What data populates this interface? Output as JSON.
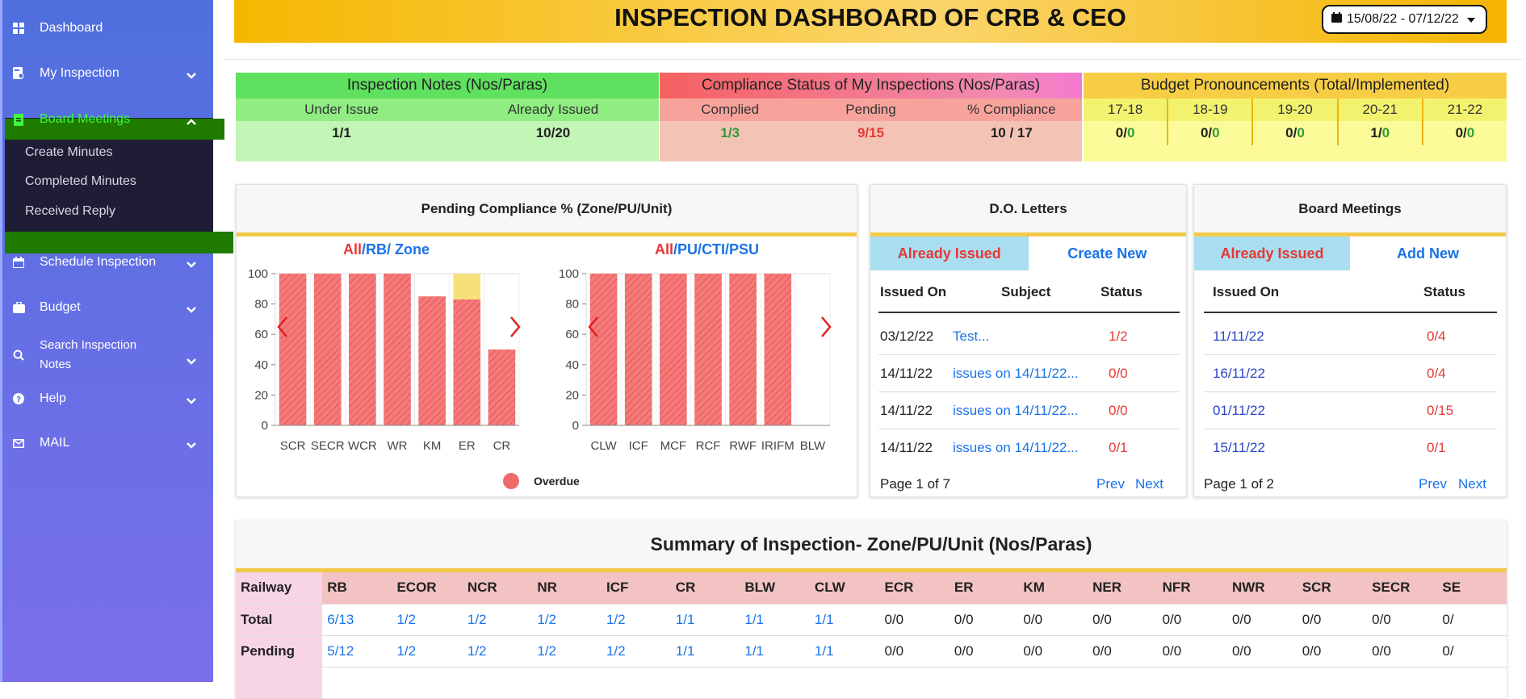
{
  "sidebar": {
    "items": [
      {
        "label": "Dashboard",
        "icon": "dashboard-icon"
      },
      {
        "label": "My Inspection",
        "icon": "inspection-icon"
      },
      {
        "label": "Board Meetings",
        "icon": "document-icon"
      },
      {
        "label": "Schedule Inspection",
        "icon": "calendar-icon"
      },
      {
        "label": "Budget",
        "icon": "briefcase-icon"
      },
      {
        "label": "Search Inspection",
        "label2": "Notes",
        "icon": "search-icon"
      },
      {
        "label": "Help",
        "icon": "help-icon"
      },
      {
        "label": "MAIL",
        "icon": "mail-icon"
      }
    ],
    "submenu": [
      "Create Minutes",
      "Completed Minutes",
      "Received Reply"
    ]
  },
  "header": {
    "title": "INSPECTION DASHBOARD OF CRB & CEO",
    "date_range": "15/08/22 - 07/12/22"
  },
  "notes": {
    "title": "Inspection Notes (Nos/Paras)",
    "cols": [
      "Under Issue",
      "Already Issued"
    ],
    "vals": [
      "1/1",
      "10/20"
    ]
  },
  "compliance": {
    "title": "Compliance Status of My Inspections (Nos/Paras)",
    "cols": [
      "Complied",
      "Pending",
      "% Compliance"
    ],
    "vals": [
      "1/3",
      "9/15",
      "10 / 17"
    ]
  },
  "budget": {
    "title": "Budget Pronouncements (Total/Implemented)",
    "years": [
      "17-18",
      "18-19",
      "19-20",
      "20-21",
      "21-22"
    ],
    "total": [
      "0/",
      "0/",
      "0/",
      "1/",
      "0/"
    ],
    "impl": [
      "0",
      "0",
      "0",
      "0",
      "0"
    ]
  },
  "pending_card": {
    "title": "Pending Compliance % (Zone/PU/Unit)",
    "left_filter": [
      "All",
      "/RB/",
      "Zone"
    ],
    "right_filter": [
      "All",
      "/PU/CTI/PSU"
    ],
    "legend": "Overdue"
  },
  "chart_data": [
    {
      "type": "bar",
      "categories": [
        "SCR",
        "SECR",
        "WCR",
        "WR",
        "KM",
        "ER",
        "CR"
      ],
      "series": [
        {
          "values": [
            100,
            100,
            100,
            100,
            85,
            83,
            50
          ]
        }
      ],
      "overflow": [
        0,
        0,
        0,
        0,
        0,
        17,
        0
      ],
      "ylim": [
        0,
        100
      ],
      "yticks": [
        0,
        20,
        40,
        60,
        80,
        100
      ],
      "colors": {
        "bar": "#f47a7a",
        "extra": "#f6e07a"
      }
    },
    {
      "type": "bar",
      "categories": [
        "CLW",
        "ICF",
        "MCF",
        "RCF",
        "RWF",
        "IRIFM",
        "BLW"
      ],
      "series": [
        {
          "values": [
            100,
            100,
            100,
            100,
            100,
            100,
            0
          ]
        }
      ],
      "ylim": [
        0,
        100
      ],
      "yticks": [
        0,
        20,
        40,
        60,
        80,
        100
      ],
      "colors": {
        "bar": "#f47a7a"
      }
    }
  ],
  "do_letters": {
    "title": "D.O. Letters",
    "tab_issued": "Already Issued",
    "tab_new": "Create New",
    "headers": [
      "Issued On",
      "Subject",
      "Status"
    ],
    "rows": [
      {
        "date": "03/12/22",
        "subject": "Test...",
        "status": "1/2"
      },
      {
        "date": "14/11/22",
        "subject": "issues on 14/11/22...",
        "status": "0/0"
      },
      {
        "date": "14/11/22",
        "subject": "issues on 14/11/22...",
        "status": "0/0"
      },
      {
        "date": "14/11/22",
        "subject": "issues on 14/11/22...",
        "status": "0/1"
      }
    ],
    "page": "Page 1 of 7",
    "prev": "Prev",
    "next": "Next"
  },
  "board": {
    "title": "Board Meetings",
    "tab_issued": "Already Issued",
    "tab_new": "Add New",
    "headers": [
      "Issued On",
      "Status"
    ],
    "rows": [
      {
        "date": "11/11/22",
        "status": "0/4"
      },
      {
        "date": "16/11/22",
        "status": "0/4"
      },
      {
        "date": "01/11/22",
        "status": "0/15"
      },
      {
        "date": "15/11/22",
        "status": "0/1"
      }
    ],
    "page": "Page 1 of 2",
    "prev": "Prev",
    "next": "Next"
  },
  "summary": {
    "title": "Summary of Inspection- Zone/PU/Unit (Nos/Paras)",
    "row_labels": [
      "Railway",
      "Total",
      "Pending"
    ],
    "railways": [
      "RB",
      "ECOR",
      "NCR",
      "NR",
      "ICF",
      "CR",
      "BLW",
      "CLW",
      "ECR",
      "ER",
      "KM",
      "NER",
      "NFR",
      "NWR",
      "SCR",
      "SECR",
      "SE"
    ],
    "total": [
      "6/13",
      "1/2",
      "1/2",
      "1/2",
      "1/2",
      "1/1",
      "1/1",
      "1/1",
      "0/0",
      "0/0",
      "0/0",
      "0/0",
      "0/0",
      "0/0",
      "0/0",
      "0/0",
      "0/"
    ],
    "pending": [
      "5/12",
      "1/2",
      "1/2",
      "1/2",
      "1/2",
      "1/1",
      "1/1",
      "1/1",
      "0/0",
      "0/0",
      "0/0",
      "0/0",
      "0/0",
      "0/0",
      "0/0",
      "0/0",
      "0/"
    ]
  }
}
